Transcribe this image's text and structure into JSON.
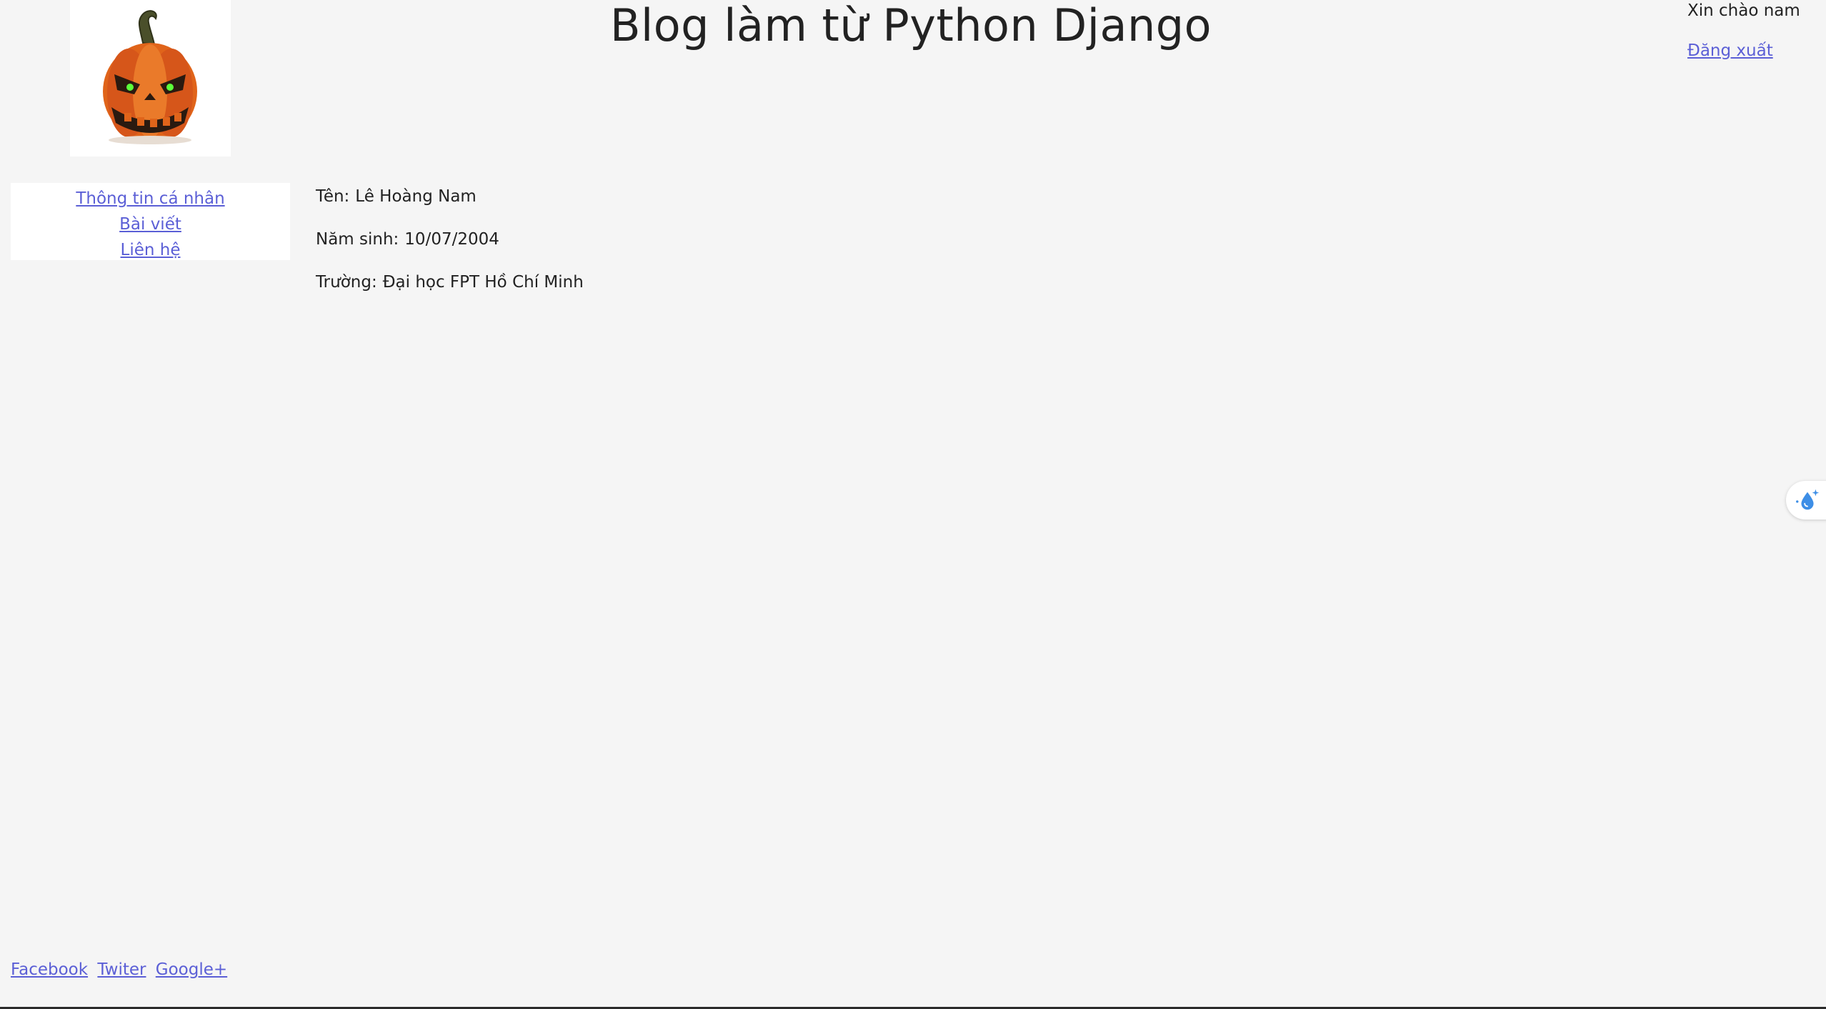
{
  "header": {
    "title": "Blog làm từ Python Django",
    "logo_icon": "pumpkin-logo-icon"
  },
  "user": {
    "greeting": "Xin chào nam",
    "logout_label": "Đăng xuất"
  },
  "sidebar": {
    "items": [
      {
        "label": "Thông tin cá nhân"
      },
      {
        "label": "Bài viết"
      },
      {
        "label": "Liên hệ"
      }
    ]
  },
  "profile": {
    "name_label": "Tên:",
    "name_value": "Lê Hoàng Nam",
    "birth_label": "Năm sinh:",
    "birth_value": "10/07/2004",
    "school_label": "Trường:",
    "school_value": "Đại học FPT Hồ Chí Minh"
  },
  "footer": {
    "links": [
      {
        "label": "Facebook"
      },
      {
        "label": "Twiter"
      },
      {
        "label": "Google+"
      }
    ]
  },
  "floating_widget": {
    "icon": "water-drop-sparkle-icon"
  },
  "colors": {
    "background": "#f5f5f5",
    "link": "#5b5fd6",
    "text": "#222222",
    "panel": "#ffffff"
  }
}
